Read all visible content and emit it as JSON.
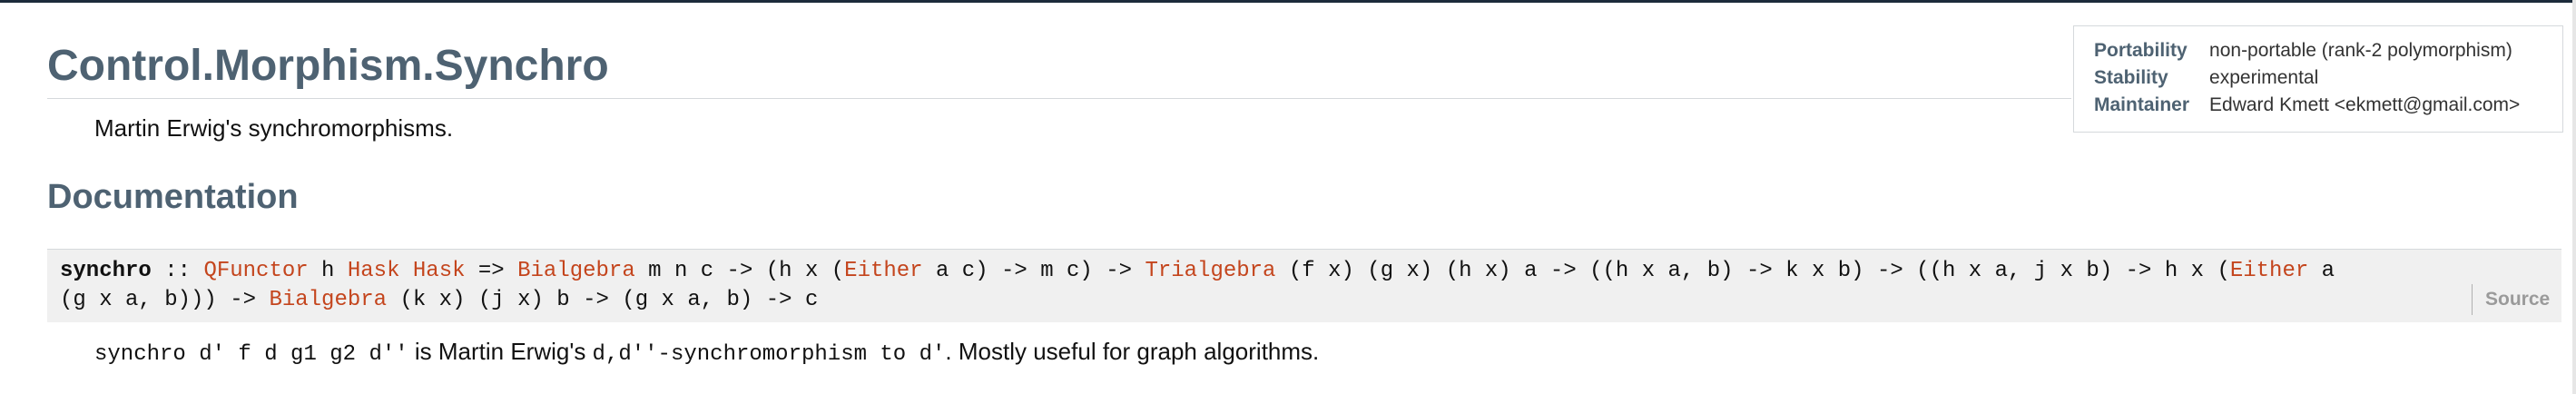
{
  "module": {
    "title": "Control.Morphism.Synchro",
    "description": "Martin Erwig's synchromorphisms."
  },
  "info": {
    "rows": [
      {
        "key": "Portability",
        "value": "non-portable (rank-2 polymorphism)"
      },
      {
        "key": "Stability",
        "value": "experimental"
      },
      {
        "key": "Maintainer",
        "value": "Edward Kmett <ekmett@gmail.com>"
      }
    ]
  },
  "documentation": {
    "heading": "Documentation"
  },
  "signature": {
    "name": "synchro",
    "line1": {
      "a": " :: ",
      "qfunctor": "QFunctor",
      "b": " h ",
      "hask1": "Hask",
      "c": " ",
      "hask2": "Hask",
      "d": " => ",
      "bialgebra1": "Bialgebra",
      "e": " m n c -> (h x (",
      "either1": "Either",
      "f": " a c) -> m c) -> ",
      "trialgebra": "Trialgebra",
      "g": " (f x) (g x) (h x) a -> ((h x a, b) -> k x b) -> ((h x a, j x b) -> h x (",
      "either2": "Either",
      "h": " a"
    },
    "line2": {
      "a": "(g x a, b))) -> ",
      "bialgebra2": "Bialgebra",
      "b": " (k x) (j x) b -> (g x a, b) -> c"
    },
    "source_label": "Source"
  },
  "doc": {
    "code1": "synchro d' f d g1 g2 d''",
    "text1": " is Martin Erwig's ",
    "code2": "d,d''-synchromorphism to d'",
    "text2": ". Mostly useful for graph algorithms."
  },
  "colors": {
    "heading": "#4e6272",
    "type_link": "#c4451d",
    "signature_bg": "#f0f0f0"
  }
}
